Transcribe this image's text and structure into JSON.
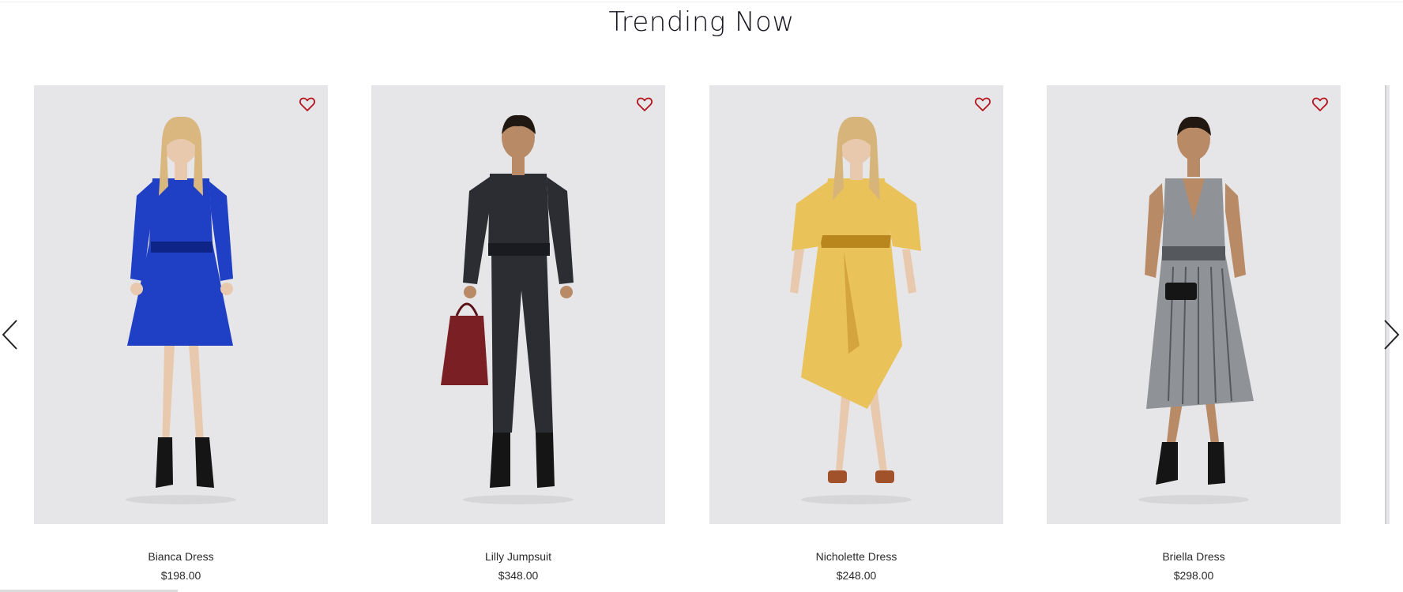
{
  "section": {
    "title": "Trending Now"
  },
  "carousel": {
    "prev_icon": "chevron-left-icon",
    "next_icon": "chevron-right-icon",
    "products": [
      {
        "name": "Bianca Dress",
        "price": "$198.00",
        "garment_color": "#1f3fc4",
        "accent_color": "#0f2487",
        "hair_color": "#d9b77e",
        "style": "short-dress",
        "wishlist_icon": "heart-outline-icon"
      },
      {
        "name": "Lilly Jumpsuit",
        "price": "$348.00",
        "garment_color": "#2b2d33",
        "accent_color": "#1a1b20",
        "hair_color": "#1f1712",
        "style": "jumpsuit",
        "wishlist_icon": "heart-outline-icon"
      },
      {
        "name": "Nicholette Dress",
        "price": "$248.00",
        "garment_color": "#e9c25a",
        "accent_color": "#b9861e",
        "hair_color": "#d7b57a",
        "style": "midi-dress",
        "wishlist_icon": "heart-outline-icon"
      },
      {
        "name": "Briella Dress",
        "price": "$298.00",
        "garment_color": "#8f9296",
        "accent_color": "#55585d",
        "hair_color": "#221812",
        "style": "pleated-dress",
        "wishlist_icon": "heart-outline-icon"
      }
    ]
  },
  "colors": {
    "heart": "#b5121b",
    "image_background": "#e6e6e8",
    "text": "#2a2a2a"
  }
}
